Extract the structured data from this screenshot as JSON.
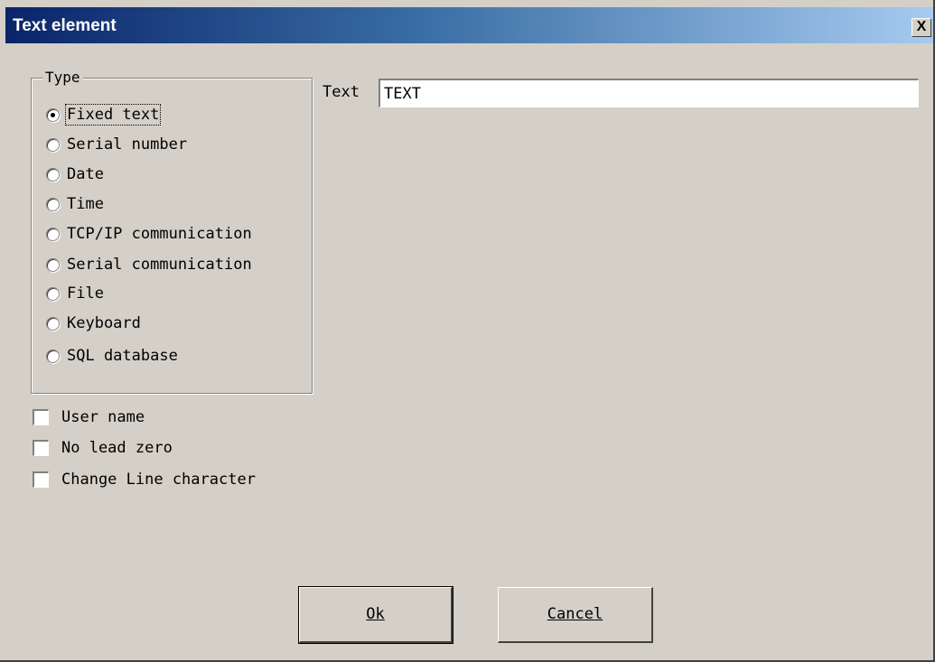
{
  "window": {
    "title": "Text element",
    "close_label": "X"
  },
  "type_group": {
    "legend": "Type",
    "options": [
      {
        "label": "Fixed text",
        "checked": true
      },
      {
        "label": "Serial number",
        "checked": false
      },
      {
        "label": "Date",
        "checked": false
      },
      {
        "label": "Time",
        "checked": false
      },
      {
        "label": "TCP/IP communication",
        "checked": false
      },
      {
        "label": "Serial communication",
        "checked": false
      },
      {
        "label": "File",
        "checked": false
      },
      {
        "label": "Keyboard",
        "checked": false
      },
      {
        "label": "SQL database",
        "checked": false
      }
    ]
  },
  "checkboxes": [
    {
      "label": "User name",
      "checked": false
    },
    {
      "label": "No lead zero",
      "checked": false
    },
    {
      "label": "Change Line character",
      "checked": false
    }
  ],
  "text_field": {
    "label": "Text",
    "value": "TEXT"
  },
  "buttons": {
    "ok": "Ok",
    "cancel": "Cancel"
  }
}
